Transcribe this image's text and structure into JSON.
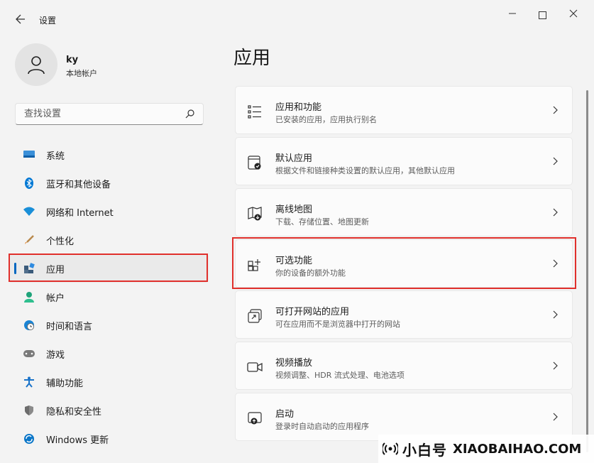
{
  "window": {
    "title": "设置",
    "back_icon": "back-arrow-icon",
    "minimize": "—",
    "close": "✕"
  },
  "user": {
    "name": "ky",
    "account_type": "本地帐户"
  },
  "search": {
    "placeholder": "查找设置"
  },
  "sidebar": {
    "items": [
      {
        "label": "系统",
        "icon": "system-icon",
        "color": "#0f6cbd"
      },
      {
        "label": "蓝牙和其他设备",
        "icon": "bluetooth-icon",
        "color": "#0078d4"
      },
      {
        "label": "网络和 Internet",
        "icon": "wifi-icon",
        "color": "#1a8fd8"
      },
      {
        "label": "个性化",
        "icon": "brush-icon",
        "color": "#e0812a"
      },
      {
        "label": "应用",
        "icon": "apps-icon",
        "color": "#3a5a7a",
        "active": true
      },
      {
        "label": "帐户",
        "icon": "account-icon",
        "color": "#1fa37a"
      },
      {
        "label": "时间和语言",
        "icon": "clock-globe-icon",
        "color": "#1b84d4"
      },
      {
        "label": "游戏",
        "icon": "gamepad-icon",
        "color": "#6e6e6e"
      },
      {
        "label": "辅助功能",
        "icon": "accessibility-icon",
        "color": "#1a73c9"
      },
      {
        "label": "隐私和安全性",
        "icon": "shield-icon",
        "color": "#7a7a7a"
      },
      {
        "label": "Windows 更新",
        "icon": "update-icon",
        "color": "#0a76c8"
      }
    ]
  },
  "main": {
    "title": "应用",
    "rows": [
      {
        "title": "应用和功能",
        "subtitle": "已安装的应用，应用执行别名",
        "icon": "apps-features-icon"
      },
      {
        "title": "默认应用",
        "subtitle": "根据文件和链接种类设置的默认应用，其他默认应用",
        "icon": "default-apps-icon"
      },
      {
        "title": "离线地图",
        "subtitle": "下载、存储位置、地图更新",
        "icon": "offline-map-icon"
      },
      {
        "title": "可选功能",
        "subtitle": "你的设备的额外功能",
        "icon": "optional-features-icon"
      },
      {
        "title": "可打开网站的应用",
        "subtitle": "可在应用而不是浏览器中打开的网站",
        "icon": "open-website-icon"
      },
      {
        "title": "视频播放",
        "subtitle": "视频调整、HDR 流式处理、电池选项",
        "icon": "video-icon"
      },
      {
        "title": "启动",
        "subtitle": "登录时自动启动的应用程序",
        "icon": "startup-icon"
      }
    ]
  },
  "watermark": {
    "cn": "小白号",
    "en": "XIAOBAIHAO.COM"
  },
  "colors": {
    "accent": "#0067c0",
    "highlight_box": "#e0302c"
  }
}
